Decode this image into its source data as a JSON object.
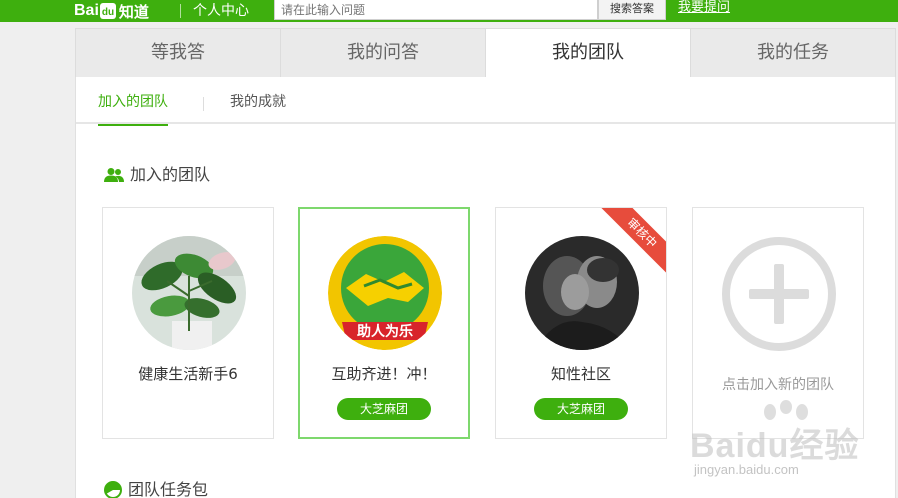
{
  "header": {
    "logo_text": "Bai",
    "logo_text2": "du",
    "logo_zhidao": "知道",
    "center_title": "个人中心",
    "search_placeholder": "请在此输入问题",
    "search_button": "搜索答案",
    "ask_link": "我要提问"
  },
  "main_tabs": [
    {
      "label": "等我答",
      "active": false
    },
    {
      "label": "我的问答",
      "active": false
    },
    {
      "label": "我的团队",
      "active": true
    },
    {
      "label": "我的任务",
      "active": false
    }
  ],
  "sub_tabs": [
    {
      "label": "加入的团队",
      "active": true
    },
    {
      "label": "我的成就",
      "active": false
    }
  ],
  "sections": {
    "joined_title": "加入的团队",
    "tasks_title": "团队任务包"
  },
  "teams": [
    {
      "name": "健康生活新手6",
      "badge": null,
      "status": null
    },
    {
      "name": "互助齐进！冲！",
      "badge": "大芝麻团",
      "status": null,
      "emblem_text": "助人为乐"
    },
    {
      "name": "知性社区",
      "badge": "大芝麻团",
      "status": "审核中"
    }
  ],
  "add_team_label": "点击加入新的团队",
  "watermark": {
    "text": "Baidu经验",
    "url": "jingyan.baidu.com"
  },
  "colors": {
    "brand_green": "#3eaf0e",
    "ribbon_red": "#e74c3c",
    "selected_border": "#7ed86d"
  }
}
